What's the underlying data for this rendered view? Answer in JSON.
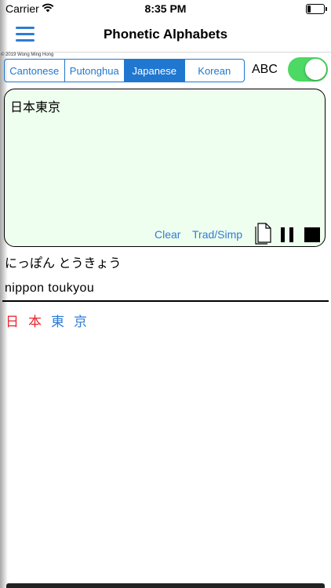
{
  "status_bar": {
    "carrier": "Carrier",
    "time": "8:35 PM",
    "wifi_icon": "wifi-icon",
    "battery_icon": "battery-icon"
  },
  "nav": {
    "title": "Phonetic Alphabets",
    "menu_icon": "hamburger-menu-icon",
    "accent_color": "#2f7bd4"
  },
  "copyright": "© 2019 Wong Ming Hong",
  "segments": {
    "items": [
      "Cantonese",
      "Putonghua",
      "Japanese",
      "Korean"
    ],
    "selected": "Japanese",
    "color": "#1f77d0"
  },
  "abc_toggle": {
    "label": "ABC",
    "on": true,
    "color": "#4cd964"
  },
  "editor": {
    "text": "日本東京",
    "background": "#efffef",
    "clear_label": "Clear",
    "trad_simp_label": "Trad/Simp",
    "copy_icon": "document-copy-icon",
    "pause_icon": "pause-icon",
    "stop_icon": "stop-icon"
  },
  "output": {
    "kana": "にっぽん とうきょう",
    "romaji": "nippon toukyou",
    "characters": [
      {
        "char": "日",
        "color": "#e8242c"
      },
      {
        "char": "本",
        "color": "#e8242c"
      },
      {
        "char": "東",
        "color": "#2f7bd4"
      },
      {
        "char": "京",
        "color": "#2f7bd4"
      }
    ]
  }
}
